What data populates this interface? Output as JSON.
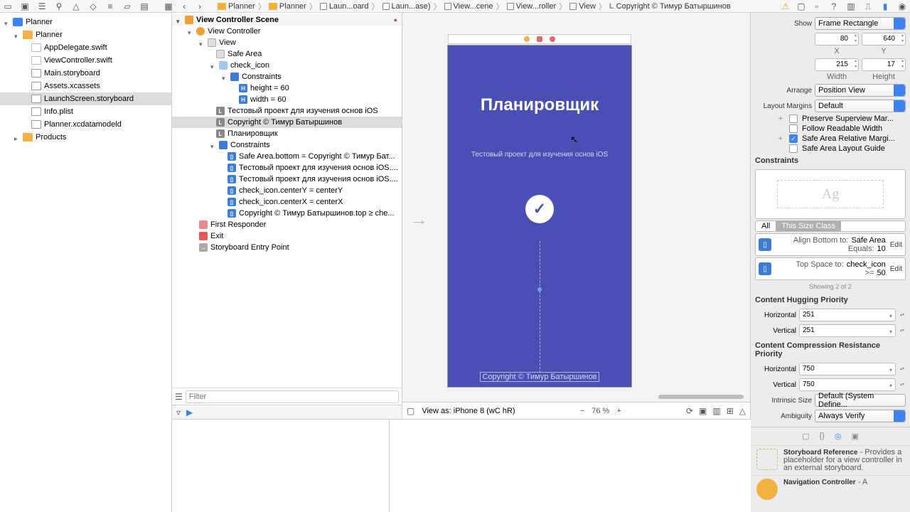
{
  "breadcrumb": [
    "Planner",
    "Planner",
    "Laun...oard",
    "Laun...ase)",
    "View...cene",
    "View...roller",
    "View",
    "Copyright © Тимур Батыршинов"
  ],
  "navigator": {
    "project": "Planner",
    "group": "Planner",
    "files": [
      "AppDelegate.swift",
      "ViewController.swift",
      "Main.storyboard",
      "Assets.xcassets",
      "LaunchScreen.storyboard",
      "Info.plist",
      "Planner.xcdatamodeld"
    ],
    "selected": "LaunchScreen.storyboard",
    "products": "Products"
  },
  "outline": {
    "scene": "View Controller Scene",
    "vc": "View Controller",
    "view": "View",
    "safe_area": "Safe Area",
    "check_icon": "check_icon",
    "cons1": "Constraints",
    "height60": "height = 60",
    "width60": "width = 60",
    "label1": "Тестовый проект для изучения основ iOS",
    "label2": "Copyright © Тимур Батыршинов",
    "label3": "Планировщик",
    "cons2": "Constraints",
    "c_items": [
      "Safe Area.bottom = Copyright © Тимур Бат...",
      "Тестовый проект для изучения основ iOS....",
      "Тестовый проект для изучения основ iOS....",
      "check_icon.centerY = centerY",
      "check_icon.centerX = centerX",
      "Copyright © Тимур Батыршинов.top ≥ che..."
    ],
    "first_responder": "First Responder",
    "exit": "Exit",
    "entry": "Storyboard Entry Point",
    "filter_placeholder": "Filter"
  },
  "canvas": {
    "title": "Планировщик",
    "subtitle": "Тестовый проект для изучения основ iOS",
    "copyright": "Copyright © Тимур Батыршинов",
    "view_as": "View as: iPhone 8 (wC hR)",
    "zoom": "76 %"
  },
  "inspector": {
    "show_label": "Show",
    "show": "Frame Rectangle",
    "x": "80",
    "y": "640",
    "xl": "X",
    "yl": "Y",
    "w": "215",
    "h": "17",
    "wl": "Width",
    "hl": "Height",
    "arrange_label": "Arrange",
    "arrange": "Position View",
    "margins_label": "Layout Margins",
    "margins": "Default",
    "chk1": "Preserve Superview Mar...",
    "chk2": "Follow Readable Width",
    "chk3": "Safe Area Relative Margi...",
    "chk4": "Safe Area Layout Guide",
    "constraints": "Constraints",
    "seg_all": "All",
    "seg_this": "This Size Class",
    "c1_l1k": "Align Bottom to:",
    "c1_l1v": "Safe Area",
    "c1_l2k": "Equals:",
    "c1_l2v": "10",
    "c2_l1k": "Top Space to:",
    "c2_l1v": "check_icon",
    "c2_l2k": ">=",
    "c2_l2v": "50",
    "edit": "Edit",
    "showing": "Showing 2 of 2",
    "chp": "Content Hugging Priority",
    "ccrp": "Content Compression Resistance Priority",
    "horiz": "Horizontal",
    "vert": "Vertical",
    "v251": "251",
    "v750": "750",
    "intrinsic_label": "Intrinsic Size",
    "intrinsic": "Default (System Define...",
    "ambiguity_label": "Ambiguity",
    "ambiguity": "Always Verify",
    "lib1_title": "Storyboard Reference",
    "lib1_desc": " - Provides a placeholder for a view controller in an external storyboard.",
    "lib2_title": "Navigation Controller",
    "lib2_desc": " - A"
  }
}
